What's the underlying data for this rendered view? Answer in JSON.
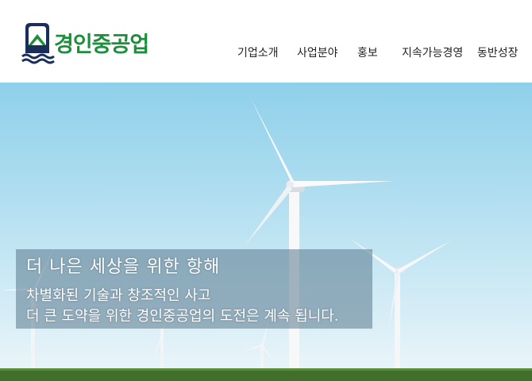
{
  "header": {
    "logo_text": "경인중공업",
    "nav": [
      "기업소개",
      "사업분야",
      "홍보",
      "지속가능경영",
      "동반성장"
    ]
  },
  "hero": {
    "title": "더 나은 세상을 위한 항해",
    "line1": "차별화된 기술과 창조적인 사고",
    "line2": "더 큰 도약을 위한 경인중공업의 도전은 계속 됩니다."
  },
  "colors": {
    "brand_green": "#1d8f3b",
    "brand_navy": "#1a2e5c",
    "sky": "#a9dbef"
  }
}
